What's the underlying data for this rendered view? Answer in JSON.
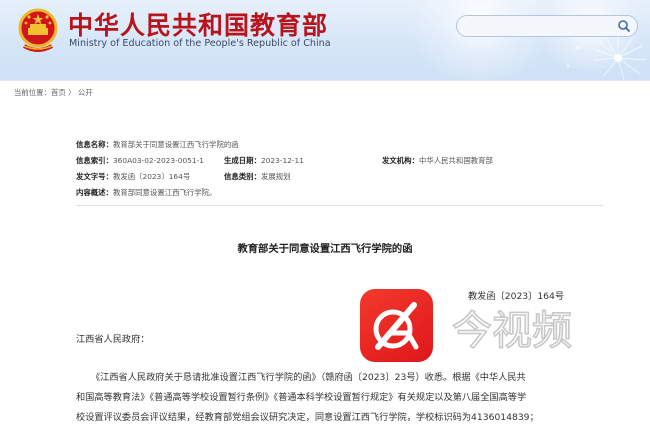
{
  "header": {
    "title": "中华人民共和国教育部",
    "subtitle": "Ministry of Education of the People's Republic of China",
    "search_placeholder": ""
  },
  "breadcrumb": {
    "label": "当前位置：",
    "home": "首页",
    "sep": "〉",
    "current": "公开"
  },
  "meta": {
    "info_name_label": "信息名称：",
    "info_name": "教育部关于同意设置江西飞行学院的函",
    "index_label": "信息索引：",
    "index": "360A03-02-2023-0051-1",
    "date_label": "生成日期：",
    "date": "2023-12-11",
    "issuer_label": "发文机构：",
    "issuer": "中华人民共和国教育部",
    "docno_label": "发文字号：",
    "docno": "教发函〔2023〕164号",
    "category_label": "信息类别：",
    "category": "发展规划",
    "summary_label": "内容概述：",
    "summary": "教育部同意设置江西飞行学院。"
  },
  "document": {
    "title": "教育部关于同意设置江西飞行学院的函",
    "number": "教发函〔2023〕164号",
    "addressee": "江西省人民政府：",
    "lines": [
      "《江西省人民政府关于恳请批准设置江西飞行学院的函》（赣府函〔2023〕23号）收悉。根据《中华人民共",
      "和国高等教育法》《普通高等学校设置暂行条例》《普通本科学校设置暂行规定》有关规定以及第八届全国高等学",
      "校设置评议委员会评议结果，经教育部党组会议研究决定，同意设置江西飞行学院，学校标识码为4136014839；"
    ]
  },
  "watermark": {
    "text": "今视频"
  },
  "colors": {
    "brand_red": "#b8141c",
    "header_bg": "#d6e6f8",
    "logo_red": "#e8261f"
  }
}
